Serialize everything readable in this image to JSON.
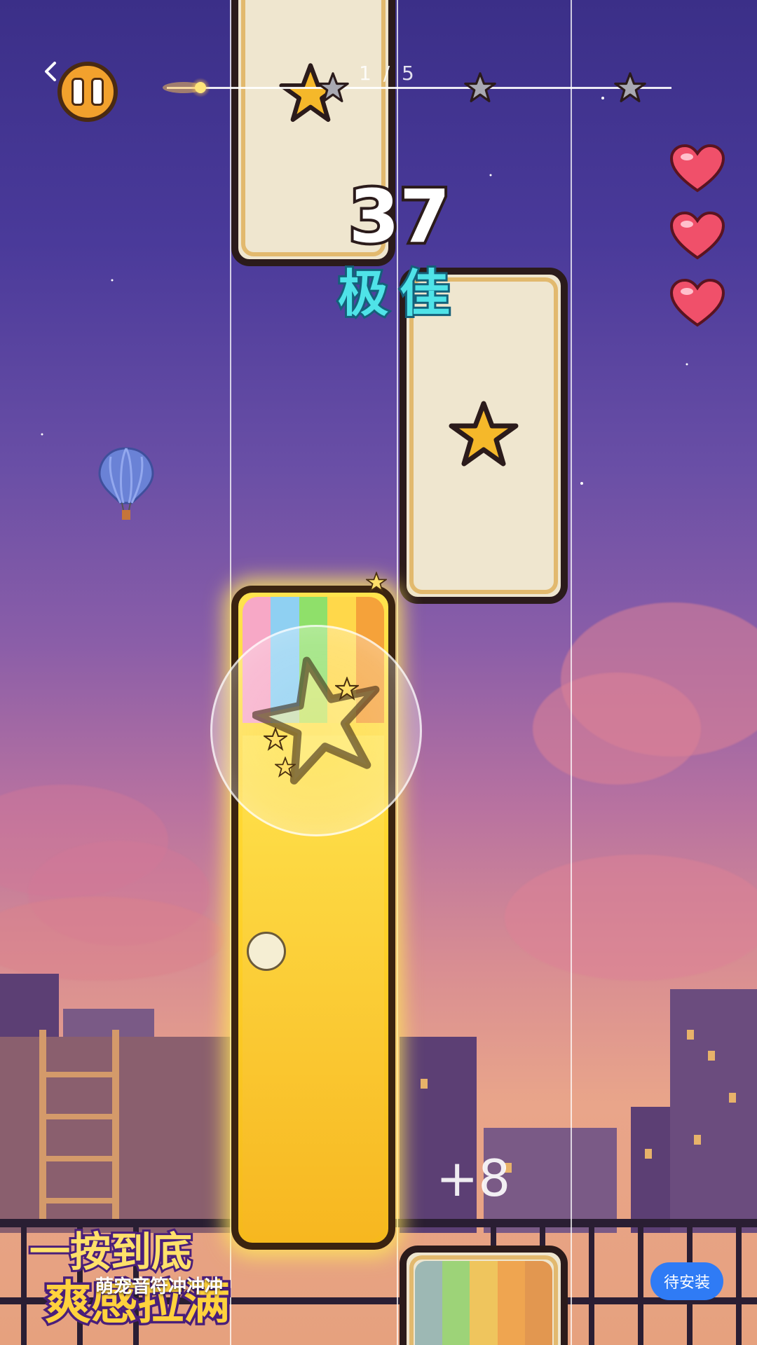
{
  "game": {
    "progress_label": "1 / 5",
    "score": "37",
    "rating": "极佳",
    "combo_bonus": "+8",
    "lives": 3,
    "progress_stars_total": 3
  },
  "ad": {
    "title_line1": "一按到底",
    "title_line2": "爽感拉满",
    "caption": "萌宠音符冲冲冲",
    "install_button": "待安装"
  },
  "colors": {
    "accent_gold": "#ffd42a",
    "rating_cyan": "#4fe3e8",
    "install_blue": "#2f7bf5",
    "heart_red": "#f0506a"
  },
  "icons": [
    "back-chevron-icon",
    "pause-icon",
    "star-icon",
    "heart-icon",
    "hot-air-balloon-icon"
  ]
}
